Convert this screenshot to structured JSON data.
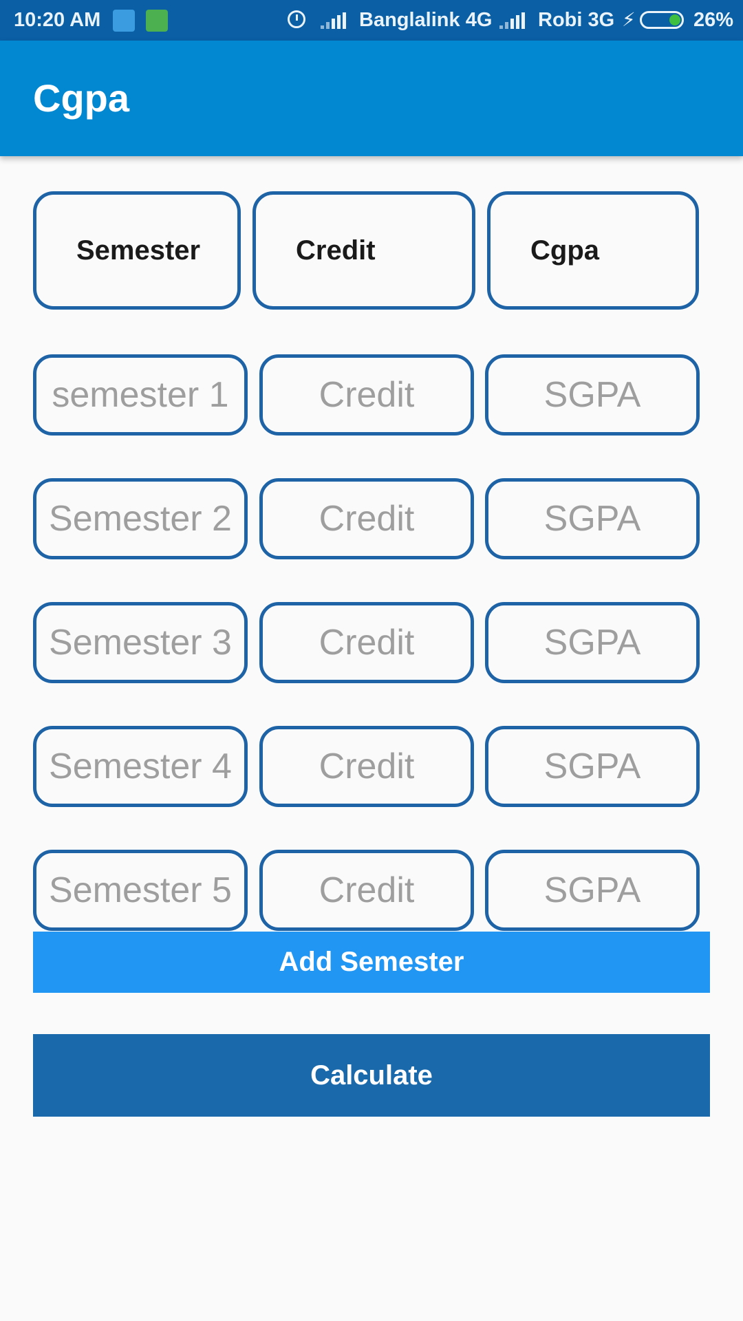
{
  "status_bar": {
    "time": "10:20 AM",
    "carrier1": "Banglalink 4G",
    "carrier2": "Robi 3G",
    "battery": "26%"
  },
  "app_bar": {
    "title": "Cgpa"
  },
  "headers": {
    "semester": "Semester",
    "credit": "Credit",
    "cgpa": "Cgpa"
  },
  "rows": [
    {
      "semester_placeholder": "semester 1",
      "credit_placeholder": "Credit",
      "sgpa_placeholder": "SGPA"
    },
    {
      "semester_placeholder": "Semester 2",
      "credit_placeholder": "Credit",
      "sgpa_placeholder": "SGPA"
    },
    {
      "semester_placeholder": "Semester 3",
      "credit_placeholder": "Credit",
      "sgpa_placeholder": "SGPA"
    },
    {
      "semester_placeholder": "Semester 4",
      "credit_placeholder": "Credit",
      "sgpa_placeholder": "SGPA"
    },
    {
      "semester_placeholder": "Semester 5",
      "credit_placeholder": "Credit",
      "sgpa_placeholder": "SGPA"
    }
  ],
  "buttons": {
    "add_semester": "Add Semester",
    "calculate": "Calculate"
  },
  "colors": {
    "status_bar": "#0a5fa5",
    "app_bar": "#0288d1",
    "box_border": "#1e63a6",
    "add_button": "#2196f3",
    "calculate_button": "#1a69ab"
  }
}
